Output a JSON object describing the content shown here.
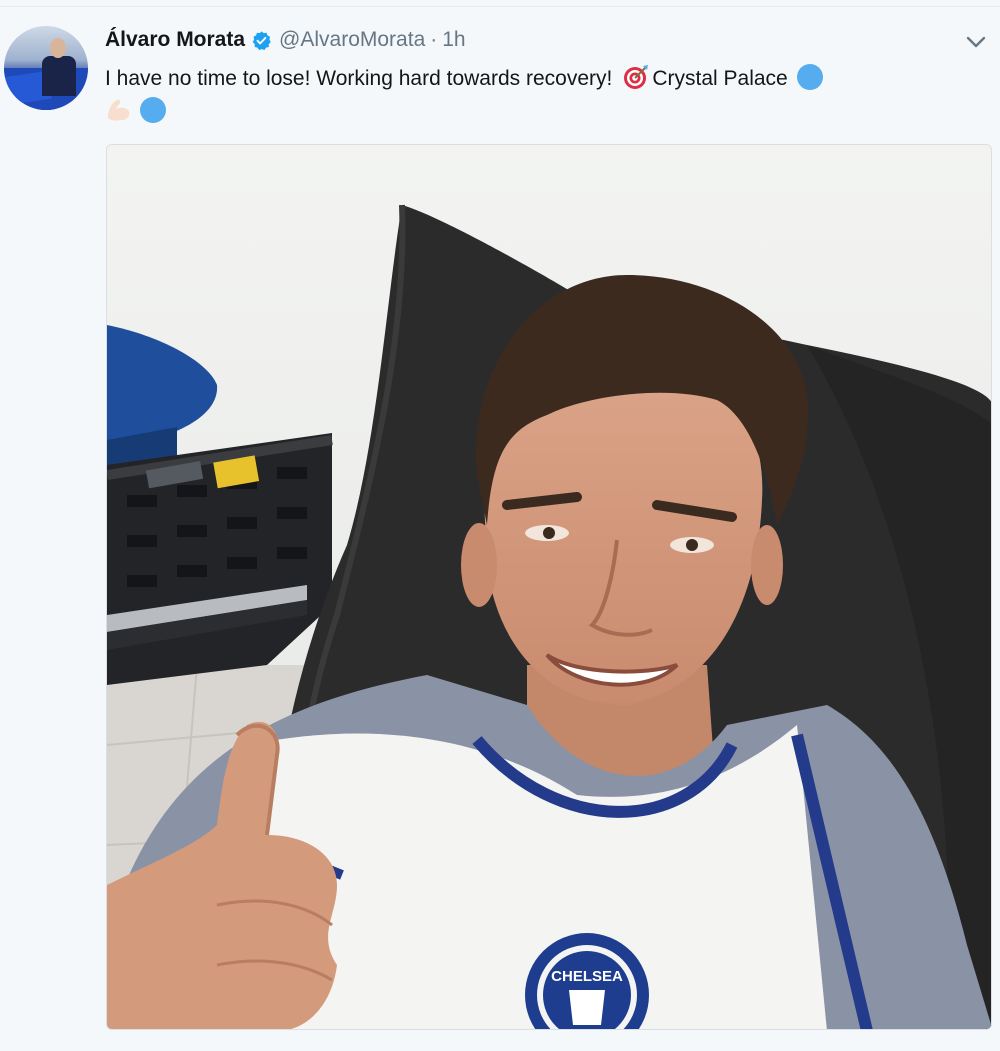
{
  "tweet": {
    "author_name": "Álvaro Morata",
    "verified": true,
    "handle": "@AlvaroMorata",
    "separator": "·",
    "time": "1h",
    "text_before": "I have no time to lose! Working hard towards recovery!",
    "location_text": "Crystal Palace",
    "icons": {
      "verified": "verified-badge-icon",
      "caret": "chevron-down-icon",
      "target_emoji": "direct-hit-emoji",
      "circle_emoji": "blue-circle-emoji",
      "flexed_bicep_emoji": "flexed-biceps-emoji"
    },
    "media": {
      "crest_text": "CHELSEA"
    }
  },
  "colors": {
    "background": "#f5f8fa",
    "verified_blue": "#1da1f2",
    "secondary_text": "#657786",
    "primary_text": "#14171a",
    "emoji_blue": "#55acee"
  }
}
